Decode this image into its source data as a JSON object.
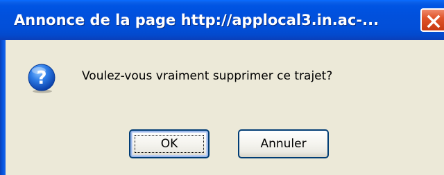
{
  "window": {
    "title": "Annonce de la page  http://applocal3.in.ac-...",
    "close_icon": "close-icon"
  },
  "dialog": {
    "icon": "question-icon",
    "message": "Voulez-vous vraiment supprimer ce trajet?",
    "buttons": {
      "ok_label": "OK",
      "cancel_label": "Annuler"
    }
  },
  "colors": {
    "titlebar": "#0054e3",
    "close_button": "#e0542a",
    "dialog_background": "#ece9d8",
    "button_border": "#003c74"
  }
}
